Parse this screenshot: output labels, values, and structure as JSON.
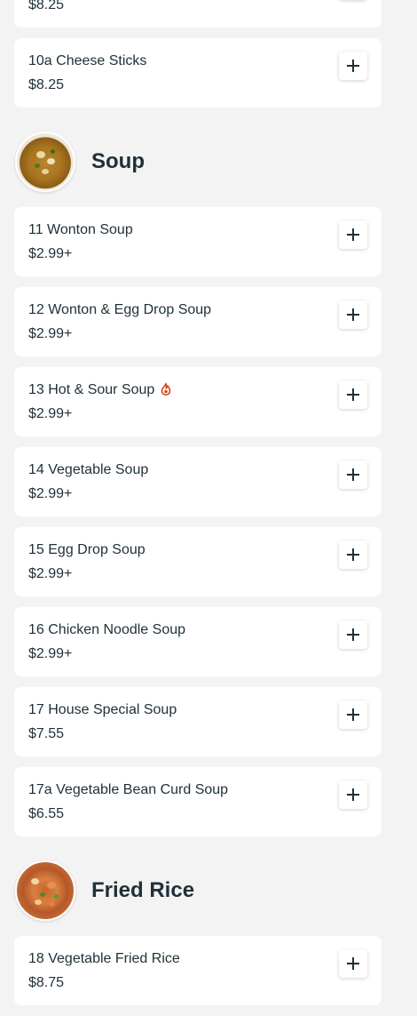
{
  "top_items": [
    {
      "name": "",
      "price": "$8.25"
    },
    {
      "name": "10a Cheese Sticks",
      "price": "$8.25"
    }
  ],
  "sections": [
    {
      "title": "Soup",
      "items": [
        {
          "name": "11 Wonton Soup",
          "price": "$2.99+"
        },
        {
          "name": "12 Wonton & Egg Drop Soup",
          "price": "$2.99+"
        },
        {
          "name": "13 Hot & Sour Soup",
          "price": "$2.99+",
          "spicy": true
        },
        {
          "name": "14 Vegetable Soup",
          "price": "$2.99+"
        },
        {
          "name": "15 Egg Drop Soup",
          "price": "$2.99+"
        },
        {
          "name": "16 Chicken Noodle Soup",
          "price": "$2.99+"
        },
        {
          "name": "17 House Special Soup",
          "price": "$7.55"
        },
        {
          "name": "17a Vegetable Bean Curd Soup",
          "price": "$6.55"
        }
      ]
    },
    {
      "title": "Fried Rice",
      "items": [
        {
          "name": "18 Vegetable Fried Rice",
          "price": "$8.75"
        }
      ]
    }
  ],
  "icons": {
    "add": "plus-icon",
    "spicy": "chili-flame-icon"
  },
  "colors": {
    "text": "#1f3038",
    "background": "#f3f3f3",
    "card": "#ffffff",
    "spicy": "#d2481d"
  }
}
